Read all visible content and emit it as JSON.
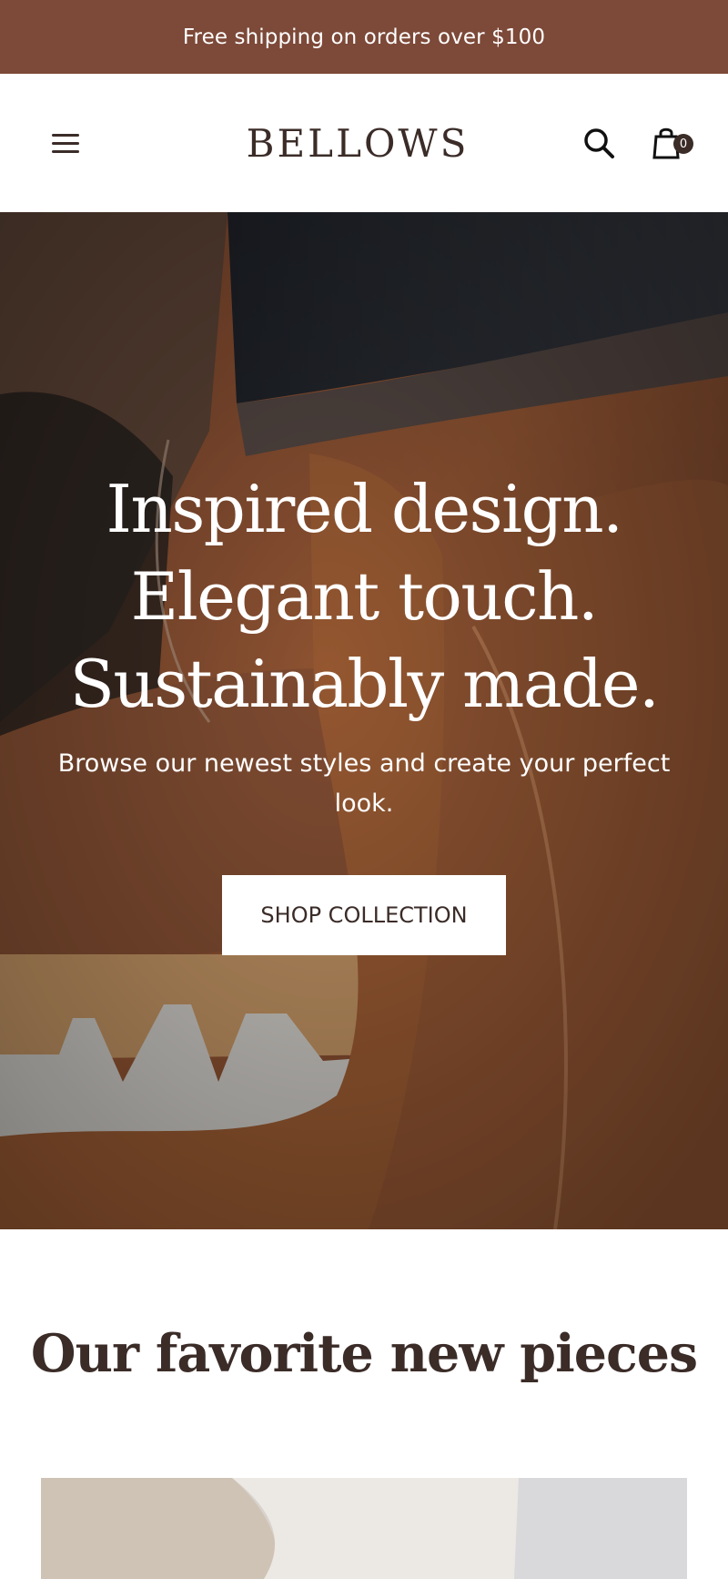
{
  "announcement": {
    "text": "Free shipping on orders over $100"
  },
  "header": {
    "logo": "BELLOWS",
    "icons": {
      "menu": "menu-icon",
      "search": "search-icon",
      "cart": "cart-icon"
    },
    "cart_count": "0"
  },
  "hero": {
    "title_lines": [
      "Inspired design.",
      "Elegant touch.",
      "Sustainably made."
    ],
    "subtitle": "Browse our newest styles and create your perfect look.",
    "button": "SHOP COLLECTION"
  },
  "featured": {
    "title": "Our favorite new pieces"
  },
  "colors": {
    "announcement": "#7d4938",
    "text": "#3b2c28",
    "hero_accent": "#a55f32"
  }
}
